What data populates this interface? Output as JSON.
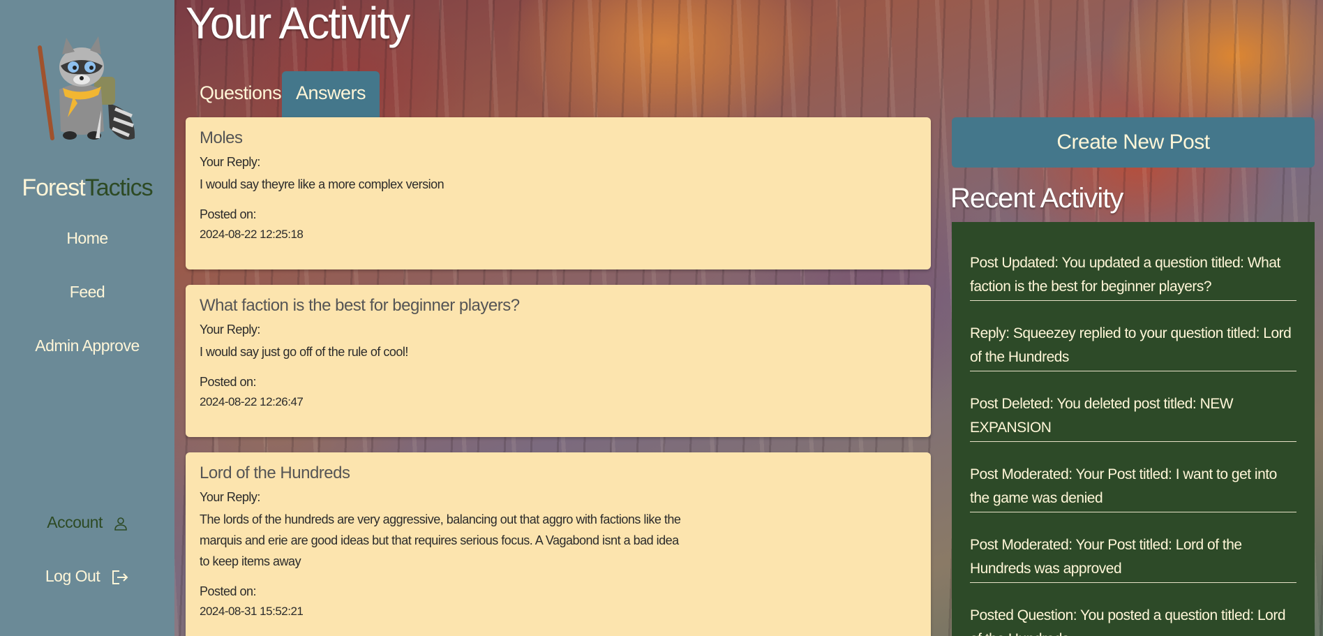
{
  "sidebar": {
    "brand_part1": "Forest",
    "brand_part2": "Tactics",
    "nav": {
      "home": "Home",
      "feed": "Feed",
      "admin": "Admin Approve",
      "account": "Account",
      "logout": "Log Out"
    },
    "icons": {
      "account": "user-icon",
      "logout": "logout-icon",
      "logo": "raccoon-mascot-logo"
    }
  },
  "page": {
    "title": "Your Activity",
    "tabs": [
      "Questions",
      "Answers"
    ],
    "active_tab": "Answers"
  },
  "answers": [
    {
      "title": "Moles",
      "reply_label": "Your Reply:",
      "reply": "I would say theyre like a more complex version",
      "posted_label": "Posted on:",
      "date": "2024-08-22 12:25:18"
    },
    {
      "title": "What faction is the best for beginner players?",
      "reply_label": "Your Reply:",
      "reply": "I would say just go off of the rule of cool!",
      "posted_label": "Posted on:",
      "date": "2024-08-22 12:26:47"
    },
    {
      "title": "Lord of the Hundreds",
      "reply_label": "Your Reply:",
      "reply": "The lords of the hundreds are very aggressive, balancing out that aggro with factions like the marquis and erie are good ideas but that requires serious focus. A Vagabond isnt a bad idea to keep items away",
      "posted_label": "Posted on:",
      "date": "2024-08-31 15:52:21"
    }
  ],
  "right": {
    "create_button": "Create New Post",
    "recent_title": "Recent Activity",
    "recent_items": [
      "Post Updated: You updated a question titled: What faction is the best for beginner players?",
      "Reply: Squeezey replied to your question titled: Lord of the Hundreds",
      "Post Deleted: You deleted post titled: NEW EXPANSION",
      "Post Moderated: Your Post titled: I want to get into the game was denied",
      "Post Moderated: Your Post titled: Lord of the Hundreds was approved",
      "Posted Question: You posted a question titled: Lord of the Hundreds"
    ]
  },
  "colors": {
    "sidebar": "#6b8a97",
    "accent": "#44778b",
    "card": "#fce4ae",
    "recent_panel": "#2d4a28",
    "brand_dark": "#2d4a24"
  }
}
